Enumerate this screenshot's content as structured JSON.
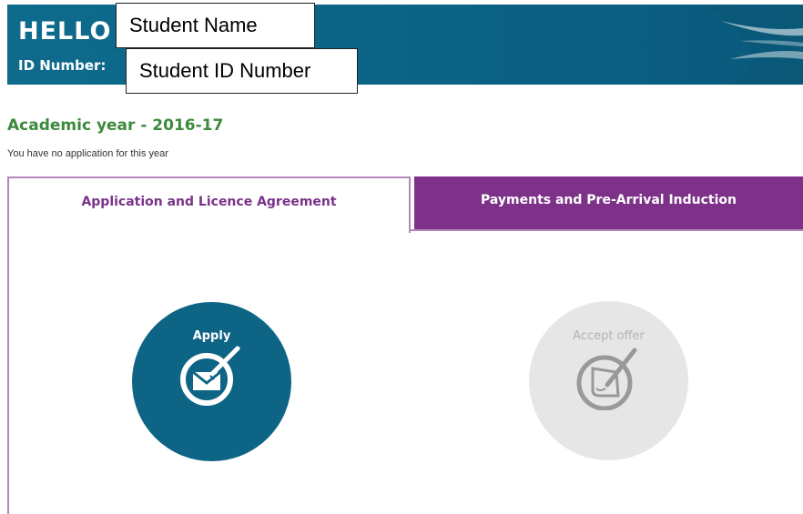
{
  "header": {
    "greeting": "HELLO",
    "id_label": "ID Number:",
    "student_name": "Student Name",
    "student_id": "Student ID Number"
  },
  "academic": {
    "year_title": "Academic year - 2016-17",
    "no_application_note": "You have no application for this year"
  },
  "tabs": [
    {
      "label": "Application and Licence Agreement",
      "active": true
    },
    {
      "label": "Payments and Pre-Arrival Induction",
      "active": false
    }
  ],
  "steps": {
    "apply": {
      "label": "Apply",
      "icon": "envelope-check-icon",
      "enabled": true
    },
    "accept": {
      "label": "Accept offer",
      "icon": "document-sign-icon",
      "enabled": false
    }
  },
  "colors": {
    "banner": "#0b6284",
    "heading_green": "#3d8a3d",
    "tab_purple": "#7d3189",
    "apply_circle": "#0d6485",
    "disabled_circle": "#e6e6e6"
  }
}
